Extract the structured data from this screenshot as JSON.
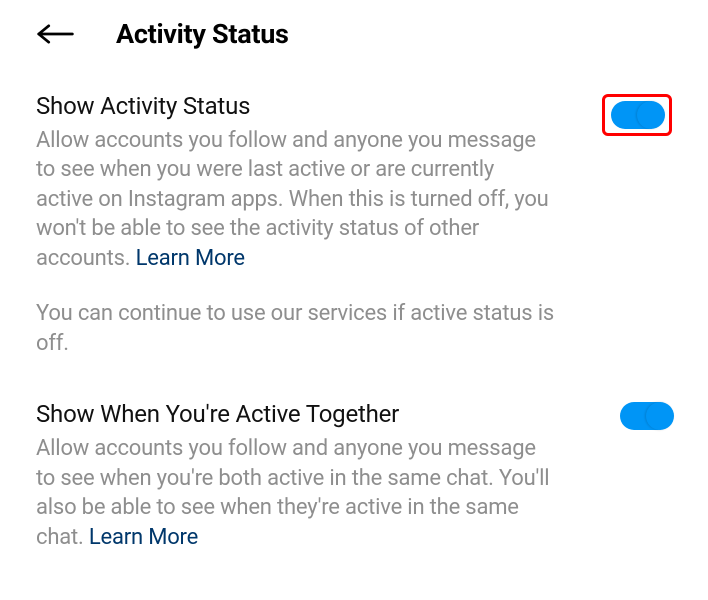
{
  "header": {
    "title": "Activity Status"
  },
  "settings": [
    {
      "title": "Show Activity Status",
      "description": "Allow accounts you follow and anyone you message to see when you were last active or are currently active on Instagram apps. When this is turned off, you won't be able to see the activity status of other accounts. ",
      "learn_more": "Learn More",
      "note": "You can continue to use our services if active status is off.",
      "toggle_on": true,
      "highlighted": true
    },
    {
      "title": "Show When You're Active Together",
      "description": "Allow accounts you follow and anyone you message to see when you're both active in the same chat. You'll also be able to see when they're active in the same chat. ",
      "learn_more": "Learn More",
      "toggle_on": true,
      "highlighted": false
    }
  ]
}
